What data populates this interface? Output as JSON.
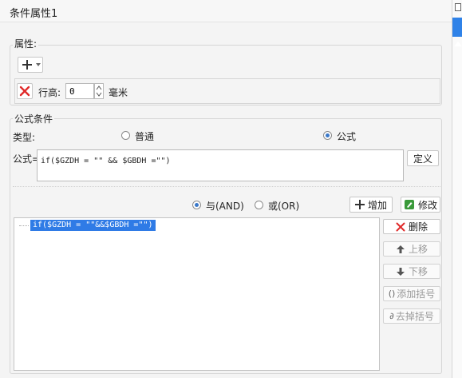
{
  "window": {
    "title": "条件属性1"
  },
  "attributes": {
    "group_label": "属性:",
    "add_button_icon": "plus-icon",
    "delete_icon": "red-x-icon",
    "row_height_label": "行高:",
    "row_height_value": "0",
    "unit_label": "毫米"
  },
  "formula_condition": {
    "group_label": "公式条件",
    "type_label": "类型:",
    "type_options": [
      {
        "label": "普通",
        "selected": false
      },
      {
        "label": "公式",
        "selected": true
      }
    ],
    "formula_label": "公式=",
    "formula_value": "if($GZDH = \"\" && $GBDH =\"\")",
    "define_button": "定义",
    "logic_options": [
      {
        "label": "与(AND)",
        "selected": true
      },
      {
        "label": "或(OR)",
        "selected": false
      }
    ],
    "add_button": "增加",
    "modify_button": "修改",
    "conditions": [
      {
        "text": "if($GZDH = \"\"&&$GBDH =\"\")",
        "selected": true
      }
    ],
    "side_buttons": [
      {
        "label": "删除",
        "icon": "red-x-icon",
        "enabled": true
      },
      {
        "label": "上移",
        "icon": "arrow-up-icon",
        "enabled": false
      },
      {
        "label": "下移",
        "icon": "arrow-down-icon",
        "enabled": false
      },
      {
        "label": "添加括号",
        "icon": "add-bracket-icon",
        "enabled": false
      },
      {
        "label": "去掉括号",
        "icon": "remove-bracket-icon",
        "enabled": false
      }
    ]
  },
  "colors": {
    "accent": "#2f82e8",
    "selection": "#2f7be6",
    "danger": "#e02a2a"
  }
}
